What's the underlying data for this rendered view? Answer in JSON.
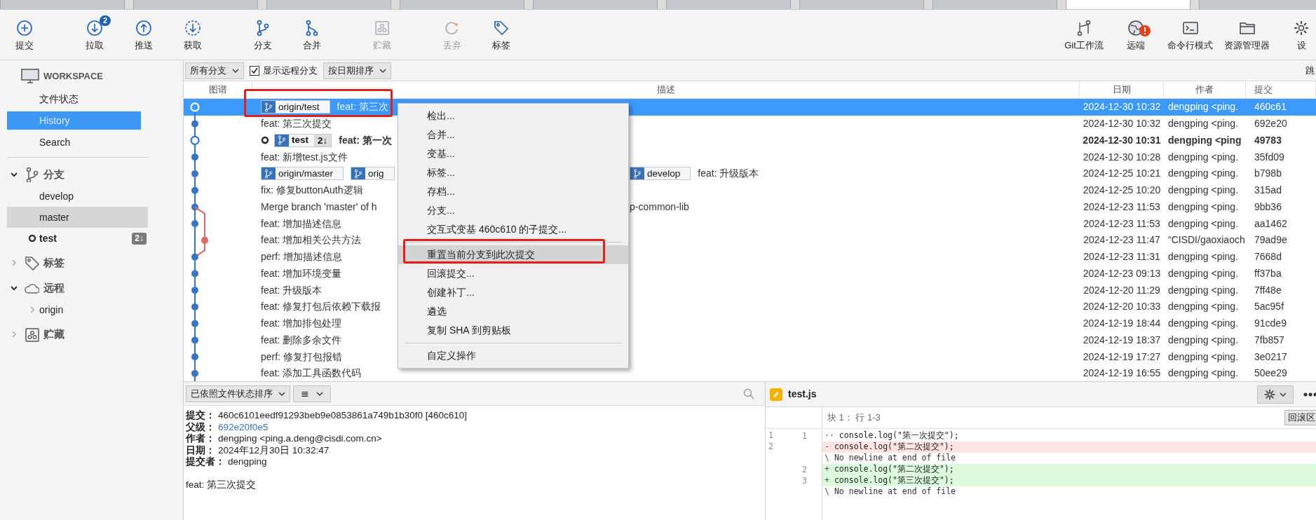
{
  "window_tabs": [
    {
      "selected": false
    },
    {
      "selected": false
    },
    {
      "selected": false
    },
    {
      "selected": false
    },
    {
      "selected": false
    },
    {
      "selected": false
    },
    {
      "selected": false
    },
    {
      "selected": false
    },
    {
      "selected": true
    },
    {
      "selected": false
    }
  ],
  "toolbar": {
    "left_groups": [
      [
        {
          "label": "提交",
          "disabled": false
        }
      ],
      [
        {
          "label": "拉取",
          "badge": "2",
          "disabled": false
        },
        {
          "label": "推送",
          "disabled": false
        },
        {
          "label": "获取",
          "disabled": false
        }
      ],
      [
        {
          "label": "分支",
          "disabled": false
        },
        {
          "label": "合并",
          "disabled": false
        }
      ],
      [
        {
          "label": "贮藏",
          "disabled": true
        }
      ],
      [
        {
          "label": "丢弃",
          "disabled": true
        },
        {
          "label": "标签",
          "disabled": false
        }
      ]
    ],
    "right": [
      {
        "label": "Git工作流"
      },
      {
        "label": "远端",
        "alert": true
      },
      {
        "label": "命令行模式"
      },
      {
        "label": "资源管理器"
      },
      {
        "label": "设"
      }
    ]
  },
  "sidebar": {
    "workspace": {
      "title": "WORKSPACE",
      "items": [
        {
          "label": "文件状态",
          "selected": false
        },
        {
          "label": "History",
          "selected": true
        },
        {
          "label": "Search",
          "selected": false
        }
      ]
    },
    "sections": [
      {
        "title": "分支",
        "expanded": true,
        "items": [
          {
            "label": "develop",
            "highlighted": false,
            "current": false
          },
          {
            "label": "master",
            "highlighted": true,
            "current": false
          },
          {
            "label": "test",
            "highlighted": false,
            "current": true,
            "badge": "2↓"
          }
        ]
      },
      {
        "title": "标签",
        "expanded": false
      },
      {
        "title": "远程",
        "expanded": true,
        "items": [
          {
            "label": "origin",
            "expandable": true
          }
        ]
      },
      {
        "title": "贮藏",
        "expanded": false
      }
    ]
  },
  "filter_bar": {
    "branch_filter": "所有分支",
    "show_remote": {
      "label": "显示远程分支",
      "checked": true
    },
    "sort": "按日期排序",
    "jump": "跳"
  },
  "commit_table": {
    "columns": [
      "图谱",
      "描述",
      "日期",
      "作者",
      "提交"
    ],
    "rows": [
      {
        "kind": "hollow",
        "selected": true,
        "current": false,
        "tags": [
          {
            "name": "origin/test"
          }
        ],
        "description": "feat: 第三次",
        "date": "2024-12-30 10:32",
        "author": "dengping <ping.",
        "commit": "460c61"
      },
      {
        "kind": "filled",
        "selected": false,
        "current": false,
        "description": "feat: 第三次提交",
        "date": "2024-12-30 10:32",
        "author": "dengping <ping.",
        "commit": "692e20"
      },
      {
        "kind": "hollow",
        "selected": false,
        "current": true,
        "tags": [
          {
            "name": "test",
            "badge": "2↓"
          }
        ],
        "description": "feat: 第一次",
        "date": "2024-12-30 10:31",
        "author": "dengping <ping",
        "commit": "49783"
      },
      {
        "kind": "filled",
        "selected": false,
        "current": false,
        "description": "feat: 新增test.js文件",
        "date": "2024-12-30 10:28",
        "author": "dengping <ping.",
        "commit": "35fd09"
      },
      {
        "kind": "filled",
        "selected": false,
        "current": false,
        "tags": [
          {
            "name": "origin/master"
          },
          {
            "name": "orig"
          }
        ],
        "right_tags": [
          {
            "name": "develop"
          }
        ],
        "right_text": "feat: 升级版本",
        "date": "2024-12-25 10:21",
        "author": "dengping <ping.",
        "commit": "b798b"
      },
      {
        "kind": "filled",
        "selected": false,
        "current": false,
        "description": "fix: 修复buttonAuth逻辑",
        "date": "2024-12-25 10:20",
        "author": "dengping <ping.",
        "commit": "315ad"
      },
      {
        "kind": "filled",
        "selected": false,
        "current": false,
        "description": "Merge branch 'master' of h",
        "right_text": "p-common-lib",
        "date": "2024-12-23 11:53",
        "author": "dengping <ping.",
        "commit": "9bb36"
      },
      {
        "kind": "filled",
        "selected": false,
        "current": false,
        "description": "feat: 增加描述信息",
        "date": "2024-12-23 11:53",
        "author": "dengping <ping.",
        "commit": "aa1462"
      },
      {
        "kind": "branch",
        "selected": false,
        "current": false,
        "description": "feat: 增加相关公共方法",
        "date": "2024-12-23 11:47",
        "author": "“CISDI/gaoxiaoch",
        "commit": "79ad9e"
      },
      {
        "kind": "filled",
        "selected": false,
        "current": false,
        "description": "perf: 增加描述信息",
        "date": "2024-12-23 11:31",
        "author": "dengping <ping.",
        "commit": "7668d"
      },
      {
        "kind": "filled",
        "selected": false,
        "current": false,
        "description": "feat: 增加环境变量",
        "date": "2024-12-23 09:13",
        "author": "dengping <ping.",
        "commit": "ff37ba"
      },
      {
        "kind": "filled",
        "selected": false,
        "current": false,
        "description": "feat: 升级版本",
        "date": "2024-12-20 11:29",
        "author": "dengping <ping.",
        "commit": "7ff48e"
      },
      {
        "kind": "filled",
        "selected": false,
        "current": false,
        "description": "feat: 修复打包后依赖下载报",
        "date": "2024-12-20 10:33",
        "author": "dengping <ping.",
        "commit": "5ac95f"
      },
      {
        "kind": "filled",
        "selected": false,
        "current": false,
        "description": "feat: 增加排包处理",
        "date": "2024-12-19 18:44",
        "author": "dengping <ping.",
        "commit": "91cde9"
      },
      {
        "kind": "filled",
        "selected": false,
        "current": false,
        "description": "feat: 删除多余文件",
        "date": "2024-12-19 18:37",
        "author": "dengping <ping.",
        "commit": "7fb857"
      },
      {
        "kind": "filled",
        "selected": false,
        "current": false,
        "description": "perf: 修复打包报错",
        "date": "2024-12-19 17:27",
        "author": "dengping <ping.",
        "commit": "3e0217"
      },
      {
        "kind": "filled",
        "selected": false,
        "current": false,
        "description": "feat: 添加工具函数代码",
        "date": "2024-12-19 16:55",
        "author": "dengping <ping.",
        "commit": "50ee29"
      }
    ]
  },
  "context_menu": [
    {
      "kind": "item",
      "label": "检出...",
      "highlighted": false
    },
    {
      "kind": "item",
      "label": "合并...",
      "highlighted": false
    },
    {
      "kind": "item",
      "label": "变基...",
      "highlighted": false
    },
    {
      "kind": "item",
      "label": "标签...",
      "highlighted": false
    },
    {
      "kind": "item",
      "label": "存档...",
      "highlighted": false
    },
    {
      "kind": "item",
      "label": "分支...",
      "highlighted": false
    },
    {
      "kind": "item",
      "label": "交互式变基 460c610 的子提交...",
      "highlighted": false
    },
    {
      "kind": "separator"
    },
    {
      "kind": "item",
      "label": "重置当前分支到此次提交",
      "highlighted": true
    },
    {
      "kind": "item",
      "label": "回滚提交...",
      "highlighted": false
    },
    {
      "kind": "item",
      "label": "创建补丁...",
      "highlighted": false
    },
    {
      "kind": "item",
      "label": "遴选",
      "highlighted": false
    },
    {
      "kind": "item",
      "label": "复制 SHA 到剪贴板",
      "highlighted": false
    },
    {
      "kind": "separator"
    },
    {
      "kind": "item",
      "label": "自定义操作",
      "highlighted": false
    }
  ],
  "details_pane": {
    "sort": "已依照文件状态排序",
    "view_icon": "≣",
    "fields": [
      {
        "kind": "text",
        "label": "提交：",
        "value": "460c6101eedf91293beb9e0853861a749b1b30f0 [460c610]"
      },
      {
        "kind": "link",
        "label": "父级：",
        "value": "692e20f0e5"
      },
      {
        "kind": "text",
        "label": "作者：",
        "value": "dengping <ping.a.deng@cisdi.com.cn>"
      },
      {
        "kind": "text",
        "label": "日期：",
        "value": "2024年12月30日 10:32:47"
      },
      {
        "kind": "text",
        "label": "提交者：",
        "value": "dengping"
      }
    ],
    "message": "feat: 第三次提交"
  },
  "diff_pane": {
    "file": "test.js",
    "hunk": "块 1： 行 1-3",
    "revert_button": "回滚区",
    "lines": [
      {
        "kind": "context",
        "old": "1",
        "new": "1",
        "prefix": "··",
        "text": "console.log(\"第一次提交\");"
      },
      {
        "kind": "removed",
        "old": "2",
        "prefix": "-",
        "text": "console.log(\"第二次提交\");"
      },
      {
        "kind": "meta",
        "prefix": "\\",
        "text": "No newline at end of file"
      },
      {
        "kind": "added",
        "new": "2",
        "prefix": "+",
        "text": "console.log(\"第二次提交\");"
      },
      {
        "kind": "added",
        "new": "3",
        "prefix": "+",
        "text": "console.log(\"第三次提交\");"
      },
      {
        "kind": "meta",
        "prefix": "\\",
        "text": "No newline at end of file"
      }
    ]
  }
}
